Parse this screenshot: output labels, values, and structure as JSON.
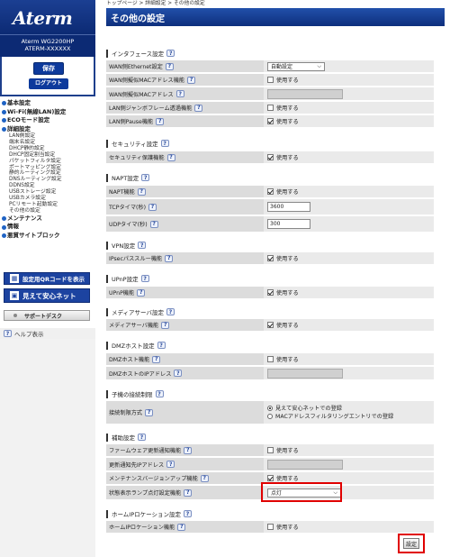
{
  "breadcrumb": "トップページ > 詳細設定 > その他の設定",
  "page_title": "その他の設定",
  "brand": {
    "logo": "Aterm",
    "model": "Aterm WG2200HP",
    "device": "ATERM-XXXXXX"
  },
  "buttons": {
    "save": "保存",
    "logout": "ログアウト",
    "qr": "設定用QRコードを表示",
    "mieru": "見えて安心ネット",
    "support": "サポートデスク",
    "help": "ヘルプ表示",
    "set": "設定"
  },
  "nav": {
    "basic": "基本設定",
    "wifi": "Wi-Fi(無線LAN)設定",
    "eco": "ECOモード設定",
    "detail": "詳細設定",
    "sub": [
      "LAN側設定",
      "端末名設定",
      "DHCP静的設定",
      "DHCP固定割当設定",
      "パケットフィルタ設定",
      "ポートマッピング設定",
      "静的ルーティング設定",
      "DNSルーティング設定",
      "DDNS設定",
      "USBストレージ設定",
      "USBカメラ設定",
      "PCリモート起動設定",
      "その他の設定"
    ],
    "maint": "メンテナンス",
    "info": "情報",
    "block": "悪質サイトブロック"
  },
  "sections": {
    "interface": {
      "title": "インタフェース設定",
      "wan_eth": "WAN側Ethernet設定",
      "wan_eth_val": "自動設定",
      "wan_mac_fn": "WAN側擬似MACアドレス機能",
      "wan_mac": "WAN側擬似MACアドレス",
      "lan_jumbo": "LAN側ジャンボフレーム透過機能",
      "lan_pause": "LAN側Pause機能"
    },
    "security": {
      "title": "セキュリティ設定",
      "protect": "セキュリティ保護機能"
    },
    "napt": {
      "title": "NAPT設定",
      "napt_fn": "NAPT機能",
      "tcp": "TCPタイマ(秒)",
      "tcp_val": "3600",
      "udp": "UDPタイマ(秒)",
      "udp_val": "300"
    },
    "vpn": {
      "title": "VPN設定",
      "ipsec": "IPsecパススルー機能"
    },
    "upnp": {
      "title": "UPnP設定",
      "upnp_fn": "UPnP機能"
    },
    "media": {
      "title": "メディアサーバ設定",
      "media_fn": "メディアサーバ機能"
    },
    "dmz": {
      "title": "DMZホスト設定",
      "dmz_fn": "DMZホスト機能",
      "dmz_ip": "DMZホストのIPアドレス"
    },
    "child": {
      "title": "子機の接続制限",
      "method": "接続制限方式",
      "opt1": "見えて安心ネットでの登録",
      "opt2": "MACアドレスフィルタリングエントリでの登録"
    },
    "aux": {
      "title": "補助設定",
      "fw": "ファームウェア更新通知機能",
      "fw_ip": "更新通知先IPアドレス",
      "maint": "メンテナンスバージョンアップ機能",
      "lamp": "状態表示ランプ点灯設定機能",
      "lamp_val": "点灯"
    },
    "home": {
      "title": "ホームIPロケーション設定",
      "home_fn": "ホームIPロケーション機能"
    }
  },
  "use_label": "使用する"
}
